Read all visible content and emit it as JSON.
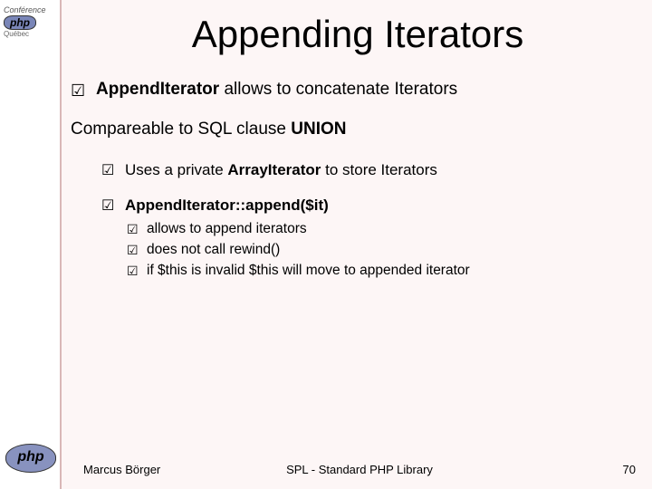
{
  "conference": {
    "line1": "Conférence",
    "php": "php",
    "region": "Québec"
  },
  "title": "Appending Iterators",
  "main": {
    "l1_pre": "AppendIterator",
    "l1_post": " allows to concatenate Iterators",
    "l2_pre": "Compareable to SQL clause ",
    "l2_bold": "UNION",
    "s1_pre": "Uses a private ",
    "s1_bold": "ArrayIterator",
    "s1_post": " to store Iterators",
    "s2_bold": "AppendIterator::append($it)",
    "ss1": "allows to append iterators",
    "ss2": "does not call rewind()",
    "ss3": "if $this is invalid $this will move to appended iterator"
  },
  "footer": {
    "author": "Marcus Börger",
    "center": "SPL - Standard PHP Library",
    "page": "70"
  },
  "php_logo_text": "php"
}
